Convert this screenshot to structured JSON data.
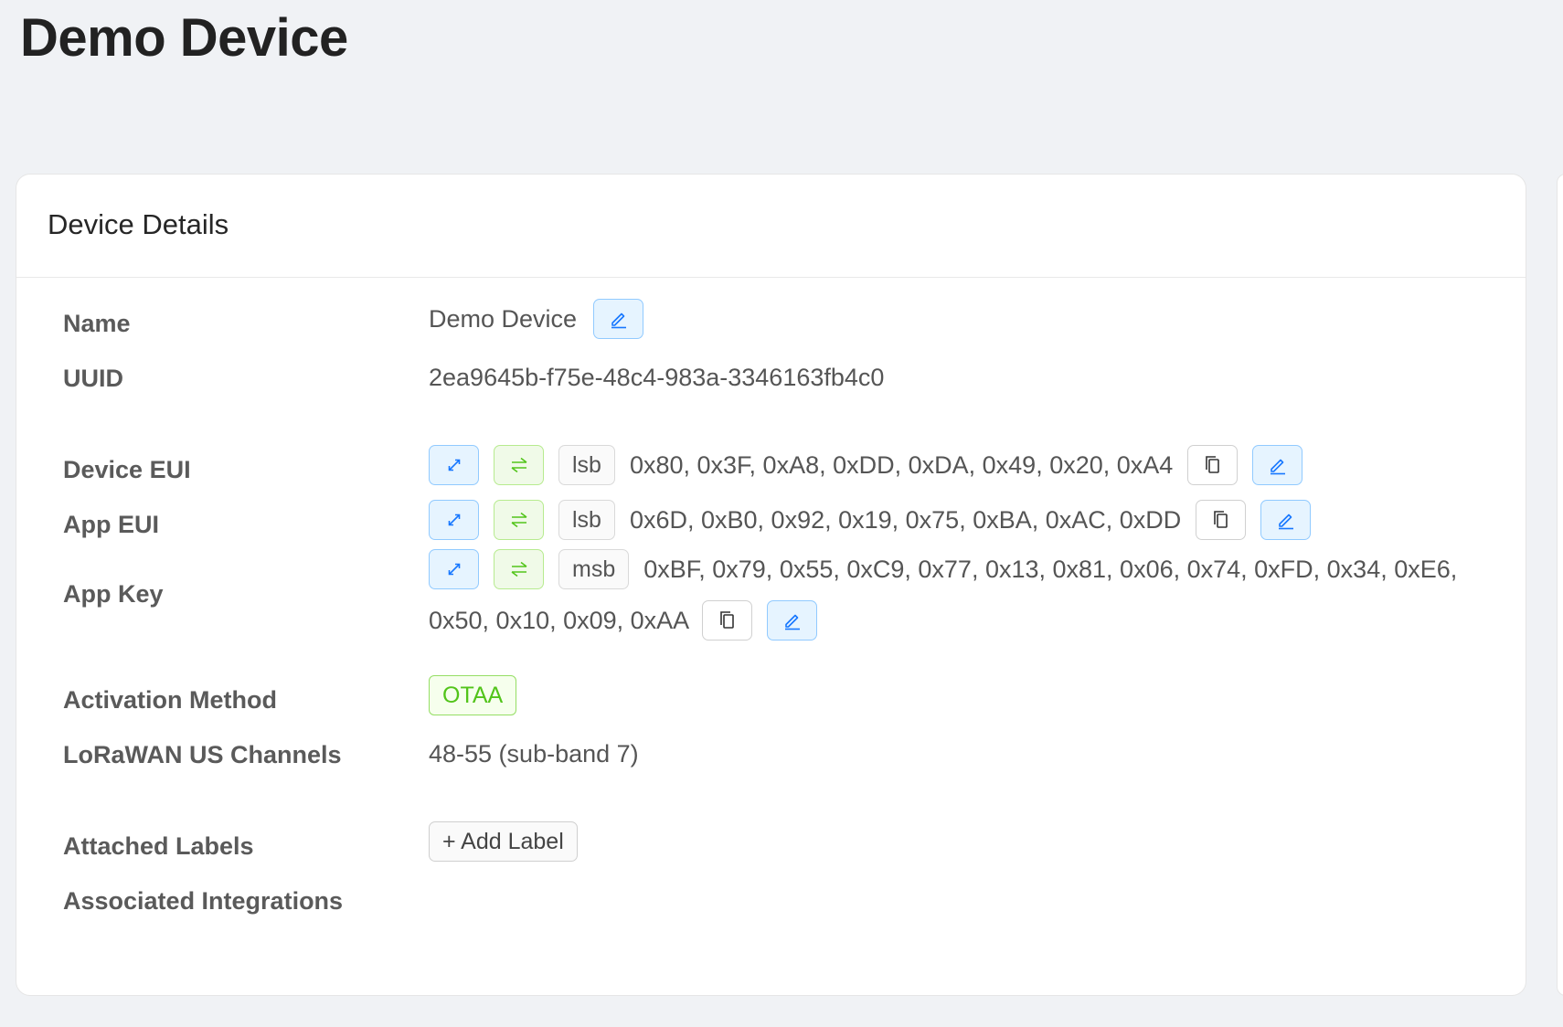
{
  "page": {
    "title": "Demo Device"
  },
  "card": {
    "title": "Device Details"
  },
  "fields": {
    "name": {
      "label": "Name",
      "value": "Demo Device"
    },
    "uuid": {
      "label": "UUID",
      "value": "2ea9645b-f75e-48c4-983a-3346163fb4c0"
    },
    "device_eui": {
      "label": "Device EUI",
      "byte_order": "lsb",
      "value": "0x80, 0x3F, 0xA8, 0xDD, 0xDA, 0x49, 0x20, 0xA4"
    },
    "app_eui": {
      "label": "App EUI",
      "byte_order": "lsb",
      "value": "0x6D, 0xB0, 0x92, 0x19, 0x75, 0xBA, 0xAC, 0xDD"
    },
    "app_key": {
      "label": "App Key",
      "byte_order": "msb",
      "value_line1": "0xBF, 0x79, 0x55, 0xC9, 0x77, 0x13, 0x81, 0x06, 0x74, 0xFD, 0x34, 0xE6,",
      "value_line2": "0x50, 0x10, 0x09, 0xAA"
    },
    "activation_method": {
      "label": "Activation Method",
      "value": "OTAA"
    },
    "lorawan_channels": {
      "label": "LoRaWAN US Channels",
      "value": "48-55 (sub-band 7)"
    },
    "attached_labels": {
      "label": "Attached Labels",
      "add_button": "+ Add Label"
    },
    "associated_integrations": {
      "label": "Associated Integrations"
    }
  },
  "icons": {
    "expand": "expand-arrows-icon",
    "swap": "swap-arrows-icon",
    "copy": "copy-icon",
    "edit": "edit-pencil-icon"
  },
  "colors": {
    "blue_button_bg": "#e6f4ff",
    "blue_button_border": "#91caff",
    "green_button_bg": "#f0fae8",
    "green_button_border": "#b7eb8f",
    "tag_green": "#52c41a",
    "page_bg": "#f0f2f5"
  }
}
